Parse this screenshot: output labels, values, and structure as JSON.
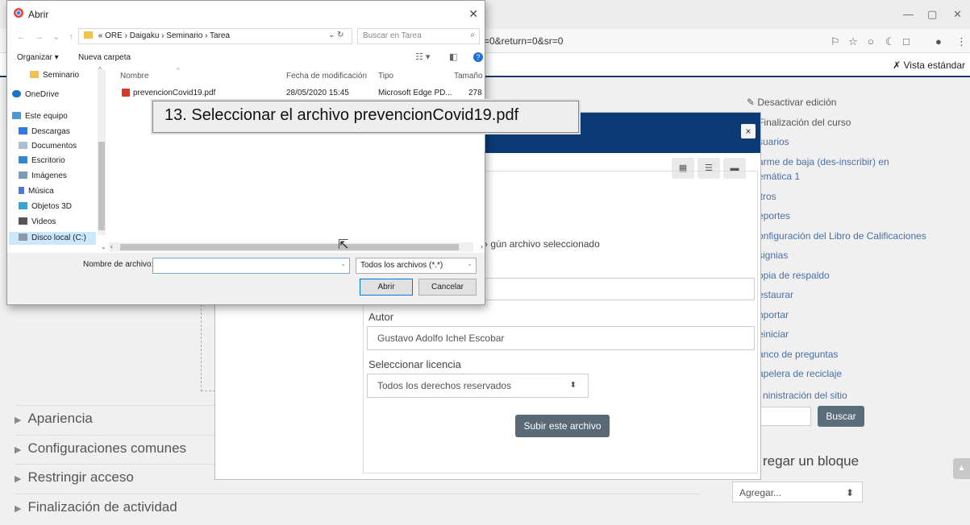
{
  "browser": {
    "address_fragment": "=0&return=0&sr=0",
    "window_controls": [
      "—",
      "▢",
      "✕"
    ]
  },
  "moodle": {
    "view_toggle": "Vista estándar",
    "admin_items": [
      "Desactivar edición",
      "Finalización del curso",
      "suarios",
      "arme de baja (des-inscribir) en",
      "emática 1",
      "ltros",
      "eportes",
      "onfiguración del Libro de Calificaciones",
      "signias",
      "opia de respaldo",
      "estaurar",
      "nportar",
      "einiciar",
      "anco de preguntas",
      "apelera de reciclaje"
    ],
    "site_admin": "ninistración del sitio",
    "search_button": "Buscar",
    "add_block_title": "regar un bloque",
    "add_block_select": "Agregar...",
    "sections": [
      "Apariencia",
      "Configuraciones comunes",
      "Restringir acceso",
      "Finalización de actividad"
    ]
  },
  "file_picker": {
    "no_file_text": "gún archivo seleccionado",
    "autor_label": "Autor",
    "autor_value": "Gustavo Adolfo Ichel Escobar",
    "license_label": "Seleccionar licencia",
    "license_value": "Todos los derechos reservados",
    "upload_button": "Subir este archivo",
    "close": "×"
  },
  "dialog": {
    "title": "Abrir",
    "breadcrumb": [
      "«",
      "ORE",
      "Daigaku",
      "Seminario",
      "Tarea"
    ],
    "search_placeholder": "Buscar en Tarea",
    "organize": "Organizar ▾",
    "new_folder": "Nueva carpeta",
    "nav_items": [
      "Seminario",
      "OneDrive",
      "Este equipo",
      "Descargas",
      "Documentos",
      "Escritorio",
      "Imágenes",
      "Música",
      "Objetos 3D",
      "Videos",
      "Disco local (C:)"
    ],
    "columns": [
      "Nombre",
      "Fecha de modificación",
      "Tipo",
      "Tamaño"
    ],
    "files": [
      {
        "name": "prevencionCovid19.pdf",
        "date": "28/05/2020 15:45",
        "type": "Microsoft Edge PD...",
        "size": "278"
      }
    ],
    "filename_label": "Nombre de archivo:",
    "filetype": "Todos los archivos (*.*)",
    "open_button": "Abrir",
    "cancel_button": "Cancelar"
  },
  "annotation": "13. Seleccionar el archivo prevencionCovid19.pdf"
}
